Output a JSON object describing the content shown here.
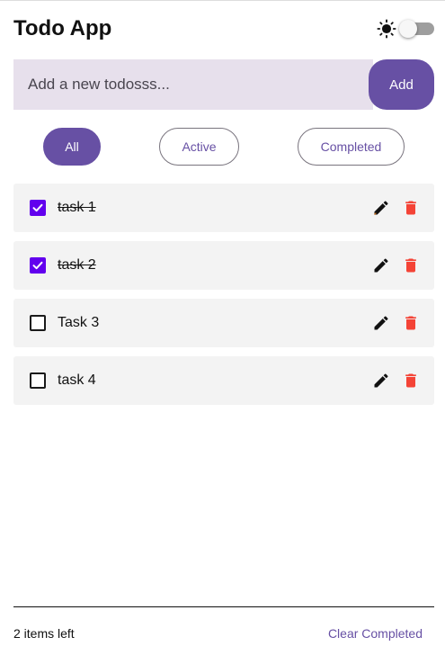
{
  "header": {
    "title": "Todo App",
    "theme_icon": "sun-icon"
  },
  "add_form": {
    "placeholder": "Add a new todosss...",
    "value": "",
    "add_label": "Add"
  },
  "filters": {
    "all": "All",
    "active": "Active",
    "completed": "Completed",
    "selected": "All"
  },
  "todos": [
    {
      "text": "task 1",
      "completed": true
    },
    {
      "text": "task 2",
      "completed": true
    },
    {
      "text": "Task 3",
      "completed": false
    },
    {
      "text": "task 4",
      "completed": false
    }
  ],
  "footer": {
    "items_left": "2 items left",
    "clear_label": "Clear Completed"
  },
  "colors": {
    "primary": "#6750a4",
    "checkbox_checked": "#6200ee",
    "delete": "#f44336",
    "input_bg": "#e7e0ec"
  }
}
